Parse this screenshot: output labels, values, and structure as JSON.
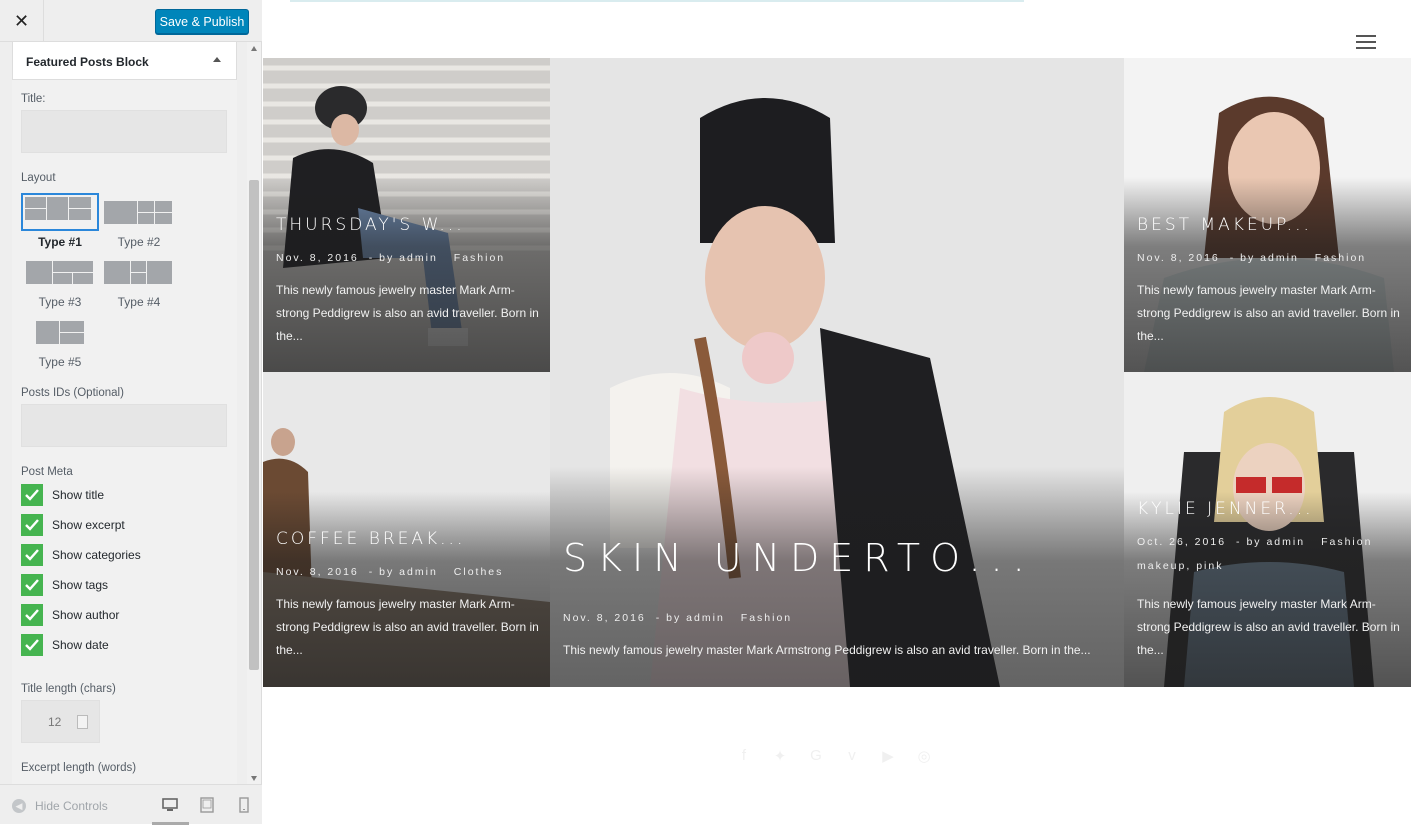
{
  "toolbar": {
    "close_glyph": "✕",
    "publish_label": "Save & Publish"
  },
  "section": {
    "title": "Featured Posts Block"
  },
  "fields": {
    "title_label": "Title:",
    "title_value": "",
    "layout_label": "Layout",
    "layouts": [
      "Type #1",
      "Type #2",
      "Type #3",
      "Type #4",
      "Type #5"
    ],
    "selected_layout": "Type #1",
    "post_ids_label": "Posts IDs (Optional)",
    "post_ids_value": "",
    "post_meta_label": "Post Meta",
    "checkboxes": [
      {
        "label": "Show title",
        "checked": true
      },
      {
        "label": "Show excerpt",
        "checked": true
      },
      {
        "label": "Show categories",
        "checked": true
      },
      {
        "label": "Show tags",
        "checked": true
      },
      {
        "label": "Show author",
        "checked": true
      },
      {
        "label": "Show date",
        "checked": true
      }
    ],
    "title_length_label": "Title length (chars)",
    "title_length_value": "12",
    "excerpt_length_label": "Excerpt length (words)"
  },
  "footer": {
    "hide_controls_label": "Hide Controls",
    "devices": [
      "desktop-icon",
      "tablet-icon",
      "mobile-icon"
    ]
  },
  "preview": {
    "posts": [
      {
        "title": "THURSDAY'S W...",
        "date": "Nov. 8, 2016",
        "author": "- by admin",
        "cats": "Fashion",
        "excerpt": "This newly famous jewelry master Mark Arm-strong Peddigrew is also an avid traveller. Born in the..."
      },
      {
        "title": "SKIN UNDERTO...",
        "date": "Nov. 8, 2016",
        "author": "- by admin",
        "cats": "Fashion",
        "excerpt": "This newly famous jewelry master Mark Armstrong Peddigrew is also an avid traveller. Born in the..."
      },
      {
        "title": "BEST MAKEUP...",
        "date": "Nov. 8, 2016",
        "author": "- by admin",
        "cats": "Fashion",
        "excerpt": "This newly famous jewelry master Mark Arm-strong Peddigrew is also an avid traveller. Born in the..."
      },
      {
        "title": "COFFEE BREAK...",
        "date": "Nov. 8, 2016",
        "author": "- by admin",
        "cats": "Clothes",
        "excerpt": "This newly famous jewelry master Mark Arm-strong Peddigrew is also an avid traveller. Born in the..."
      },
      {
        "title": "KYLIE JENNER...",
        "date": "Oct. 26, 2016",
        "author": "- by admin",
        "cats": "Fashion",
        "tags": "makeup, pink",
        "excerpt": "This newly famous jewelry master Mark Arm-strong Peddigrew is also an avid traveller. Born in the..."
      }
    ],
    "social_icons": [
      "facebook-icon",
      "twitter-icon",
      "google-plus-icon",
      "vimeo-icon",
      "youtube-icon",
      "pinterest-icon"
    ]
  },
  "colors": {
    "accent": "#0085ba",
    "check": "#46b450",
    "selected_border": "#2b87da"
  }
}
